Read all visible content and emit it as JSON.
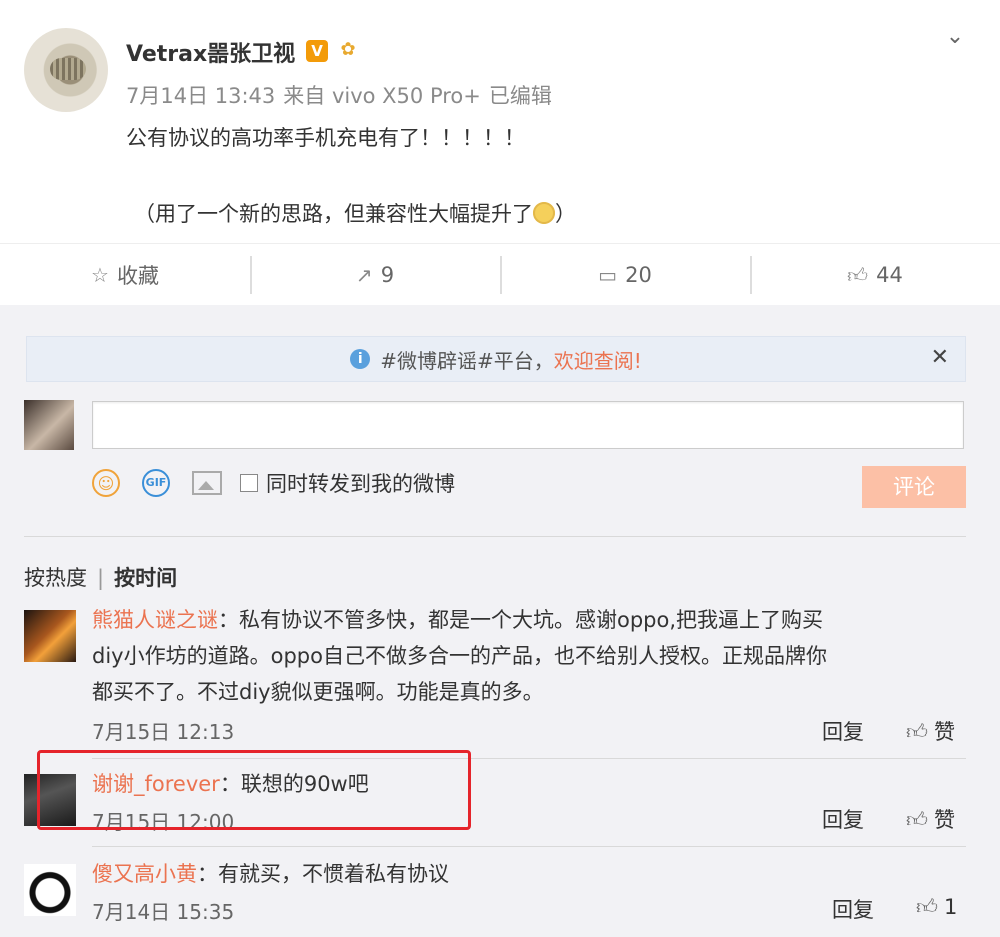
{
  "post": {
    "username": "Vetrax噐张卫视",
    "verified_badge": "V",
    "meta": {
      "date": "7月14日 13:43",
      "source": "来自 vivo X50 Pro+",
      "edited": "已编辑"
    },
    "content_line1": "公有协议的高功率手机充电有了！！！！！",
    "content_line2": "（用了一个新的思路，但兼容性大幅提升了",
    "content_line2_end": "）"
  },
  "actions": [
    {
      "label": "收藏",
      "icon": "star-outline-icon",
      "glyph": "☆"
    },
    {
      "label": "9",
      "icon": "repost-icon",
      "glyph": "↗"
    },
    {
      "label": "20",
      "icon": "comment-icon",
      "glyph": "▭"
    },
    {
      "label": "44",
      "icon": "thumbs-up-icon",
      "glyph": "👍︎"
    }
  ],
  "notice": {
    "text": "#微博辟谣#平台，",
    "link": "欢迎查阅!"
  },
  "composer": {
    "repost_label": "同时转发到我的微博",
    "submit_label": "评论",
    "placeholder": ""
  },
  "sort": {
    "hot": "按热度",
    "time": "按时间"
  },
  "comments": [
    {
      "name": "熊猫人谜之谜",
      "text_l1": "：私有协议不管多快，都是一个大坑。感谢oppo,把我逼上了购买",
      "text_l2": "diy小作坊的道路。oppo自己不做多合一的产品，也不给别人授权。正规品牌你",
      "text_l3": "都买不了。不过diy貌似更强啊。功能是真的多。",
      "time": "7月15日 12:13",
      "reply": "回复",
      "like": "赞"
    },
    {
      "name": "谢谢_forever",
      "text_l1": "：联想的90w吧",
      "time": "7月15日 12:00",
      "reply": "回复",
      "like": "赞"
    },
    {
      "name": "傻又高小黄",
      "text_l1": "：有就买，不惯着私有协议",
      "time": "7月14日 15:35",
      "reply": "回复",
      "like": "1"
    }
  ],
  "colors": {
    "accent": "#eb7350",
    "highlight": "#e5242b",
    "submit_disabled": "#fcc0a6"
  }
}
